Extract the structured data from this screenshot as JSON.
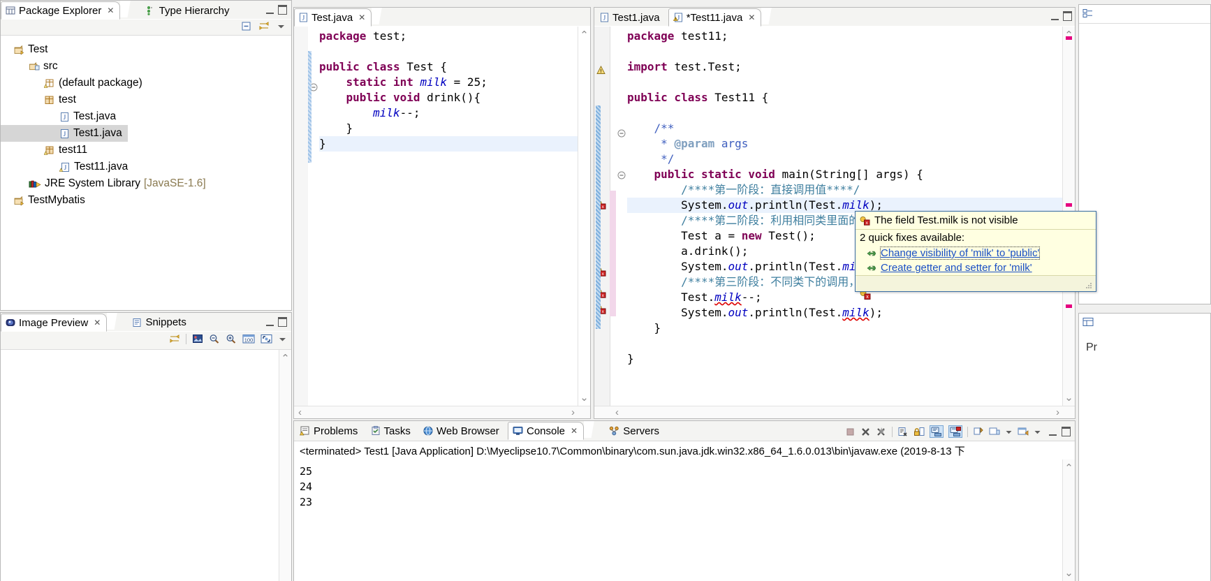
{
  "package_explorer": {
    "tabs": [
      {
        "label": "Package Explorer",
        "icon": "package-explorer-icon",
        "active": true,
        "closable": true
      },
      {
        "label": "Type Hierarchy",
        "icon": "type-hierarchy-icon",
        "active": false,
        "closable": false
      }
    ],
    "toolbar": [
      {
        "name": "collapse-all-icon"
      },
      {
        "name": "link-with-editor-icon"
      },
      {
        "name": "view-menu-icon"
      }
    ],
    "tree": [
      {
        "label": "Test",
        "icon": "java-project-icon",
        "indent": 0,
        "selected": false
      },
      {
        "label": "src",
        "icon": "source-folder-icon",
        "indent": 1,
        "selected": false
      },
      {
        "label": "(default package)",
        "icon": "package-empty-icon",
        "indent": 2,
        "selected": false
      },
      {
        "label": "test",
        "icon": "package-icon",
        "indent": 2,
        "selected": false
      },
      {
        "label": "Test.java",
        "icon": "java-file-icon",
        "indent": 3,
        "selected": false
      },
      {
        "label": "Test1.java",
        "icon": "java-file-icon",
        "indent": 3,
        "selected": true
      },
      {
        "label": "test11",
        "icon": "package-warning-icon",
        "indent": 2,
        "selected": false
      },
      {
        "label": "Test11.java",
        "icon": "java-file-warning-icon",
        "indent": 3,
        "selected": false
      },
      {
        "label": "JRE System Library",
        "suffix": "[JavaSE-1.6]",
        "icon": "library-icon",
        "indent": 1,
        "selected": false
      },
      {
        "label": "TestMybatis",
        "icon": "java-project-icon",
        "indent": 0,
        "selected": false
      }
    ]
  },
  "image_preview": {
    "tabs": [
      {
        "label": "Image Preview",
        "icon": "image-preview-icon",
        "active": true,
        "closable": true
      },
      {
        "label": "Snippets",
        "icon": "snippets-icon",
        "active": false,
        "closable": false
      }
    ],
    "toolbar": [
      {
        "name": "link-with-editor-icon"
      },
      {
        "name": "image-thumb-icon"
      },
      {
        "name": "zoom-out-icon"
      },
      {
        "name": "zoom-in-icon"
      },
      {
        "name": "zoom-100-icon"
      },
      {
        "name": "fit-to-window-icon"
      },
      {
        "name": "view-menu-icon"
      }
    ]
  },
  "editor_left": {
    "tabs": [
      {
        "label": "Test.java",
        "icon": "java-file-icon",
        "active": true,
        "closable": true
      }
    ],
    "lines": [
      [
        {
          "t": "package ",
          "c": "kw"
        },
        {
          "t": "test;",
          "c": "plain"
        }
      ],
      [],
      [
        {
          "t": "public class ",
          "c": "kw"
        },
        {
          "t": "Test {",
          "c": "plain"
        }
      ],
      [
        {
          "t": "    static int ",
          "c": "kw"
        },
        {
          "t": "milk",
          "c": "fld"
        },
        {
          "t": " = 25;",
          "c": "plain"
        }
      ],
      [
        {
          "t": "    public void ",
          "c": "kw"
        },
        {
          "t": "drink(){",
          "c": "plain"
        }
      ],
      [
        {
          "t": "        ",
          "c": "plain"
        },
        {
          "t": "milk",
          "c": "fld"
        },
        {
          "t": "--;",
          "c": "plain"
        }
      ],
      [
        {
          "t": "    }",
          "c": "plain"
        }
      ],
      [
        {
          "t": "}",
          "c": "plain",
          "hl": true
        }
      ]
    ]
  },
  "editor_right": {
    "tabs": [
      {
        "label": "Test1.java",
        "icon": "java-file-icon",
        "active": false,
        "closable": false
      },
      {
        "label": "*Test11.java",
        "icon": "java-file-warning-icon",
        "active": true,
        "closable": true
      }
    ],
    "lines": [
      [
        {
          "t": "package ",
          "c": "kw"
        },
        {
          "t": "test11;",
          "c": "plain"
        }
      ],
      [],
      [
        {
          "t": "import ",
          "c": "kw"
        },
        {
          "t": "test.Test;",
          "c": "plain"
        }
      ],
      [],
      [
        {
          "t": "public class ",
          "c": "kw"
        },
        {
          "t": "Test11 {",
          "c": "plain"
        }
      ],
      [],
      [
        {
          "t": "    /**",
          "c": "jdoc"
        }
      ],
      [
        {
          "t": "     * ",
          "c": "jdoc"
        },
        {
          "t": "@param",
          "c": "jdtag"
        },
        {
          "t": " args",
          "c": "jdoc"
        }
      ],
      [
        {
          "t": "     */",
          "c": "jdoc"
        }
      ],
      [
        {
          "t": "    public static void ",
          "c": "kw"
        },
        {
          "t": "main(String[] args) {",
          "c": "plain"
        }
      ],
      [
        {
          "t": "        /****第一阶段：直接调用值****/",
          "c": "cmt"
        }
      ],
      [
        {
          "t": "        System.",
          "c": "plain"
        },
        {
          "t": "out",
          "c": "fld"
        },
        {
          "t": ".println(Test.",
          "c": "plain"
        },
        {
          "t": "milk",
          "c": "fld"
        },
        {
          "t": ");",
          "c": "plain"
        }
      ],
      [
        {
          "t": "        /****第二阶段：利用相同类里面的方法来调用****/",
          "c": "cmt"
        }
      ],
      [
        {
          "t": "        Test a = ",
          "c": "plain"
        },
        {
          "t": "new ",
          "c": "kw"
        },
        {
          "t": "Test();",
          "c": "plain"
        }
      ],
      [
        {
          "t": "        a.drink();",
          "c": "plain"
        }
      ],
      [
        {
          "t": "        System.",
          "c": "plain"
        },
        {
          "t": "out",
          "c": "fld"
        },
        {
          "t": ".println(Test.",
          "c": "plain"
        },
        {
          "t": "milk",
          "c": "fld"
        },
        {
          "t": ");",
          "c": "plain"
        }
      ],
      [
        {
          "t": "        /****第三阶段：不同类下的调用，并修改值****/",
          "c": "cmt"
        }
      ],
      [
        {
          "t": "        Test.",
          "c": "plain"
        },
        {
          "t": "milk",
          "c": "fld",
          "err": true
        },
        {
          "t": "--;",
          "c": "plain"
        }
      ],
      [
        {
          "t": "        System.",
          "c": "plain"
        },
        {
          "t": "out",
          "c": "fld"
        },
        {
          "t": ".println(Test.",
          "c": "plain"
        },
        {
          "t": "milk",
          "c": "fld",
          "err": true
        },
        {
          "t": ");",
          "c": "plain"
        }
      ],
      [
        {
          "t": "    }",
          "c": "plain"
        }
      ],
      [],
      [
        {
          "t": "}",
          "c": "plain"
        }
      ]
    ],
    "highlight_line_index": 11
  },
  "quick_fix_popup": {
    "icon": "error-quickfix-icon",
    "title": "The field Test.milk is not visible",
    "subtitle": "2 quick fixes available:",
    "fixes": [
      {
        "icon": "quickfix-change-icon",
        "label": "Change visibility of 'milk' to 'public'",
        "focused": true
      },
      {
        "icon": "quickfix-create-icon",
        "label": "Create getter and setter for 'milk'",
        "focused": false
      }
    ],
    "footer_icon": "resize-grip-icon"
  },
  "bottom_panel": {
    "tabs": [
      {
        "label": "Problems",
        "icon": "problems-icon",
        "active": false,
        "closable": false
      },
      {
        "label": "Tasks",
        "icon": "tasks-icon",
        "active": false,
        "closable": false
      },
      {
        "label": "Web Browser",
        "icon": "web-browser-icon",
        "active": false,
        "closable": false
      },
      {
        "label": "Console",
        "icon": "console-icon",
        "active": true,
        "closable": true
      },
      {
        "label": "Servers",
        "icon": "servers-icon",
        "active": false,
        "closable": false
      }
    ],
    "toolbar": [
      {
        "name": "terminate-icon"
      },
      {
        "name": "remove-launch-icon"
      },
      {
        "name": "remove-all-terminated-icon"
      },
      {
        "name": "clear-console-icon"
      },
      {
        "name": "scroll-lock-icon"
      },
      {
        "name": "show-console-on-output-icon"
      },
      {
        "name": "show-console-on-error-icon"
      },
      {
        "name": "pin-console-icon"
      },
      {
        "name": "display-selected-console-icon"
      },
      {
        "name": "dropdown-arrow-icon"
      },
      {
        "name": "open-console-icon"
      },
      {
        "name": "open-console-dropdown-icon"
      }
    ],
    "status_line": "<terminated> Test1 [Java Application] D:\\Myeclipse10.7\\Common\\binary\\com.sun.java.jdk.win32.x86_64_1.6.0.013\\bin\\javaw.exe (2019-8-13 下",
    "output_lines": [
      "25",
      "24",
      "23"
    ]
  },
  "right_rail": {
    "outline_icon": "outline-icon",
    "properties_icon": "properties-icon",
    "properties_label": "Pr"
  },
  "colors": {
    "keyword": "#7f0055",
    "field": "#0000c0",
    "comment": "#3f7f9f",
    "javadoc": "#3f5fbf",
    "selection": "#d6d6d6",
    "highlight_line": "#eaf2fd",
    "tooltip_bg": "#ffffe1",
    "tooltip_border": "#3a6ea5",
    "link": "#1a4fc4",
    "overview_marker": "#e5007f",
    "error_marker": "#cc0000"
  }
}
